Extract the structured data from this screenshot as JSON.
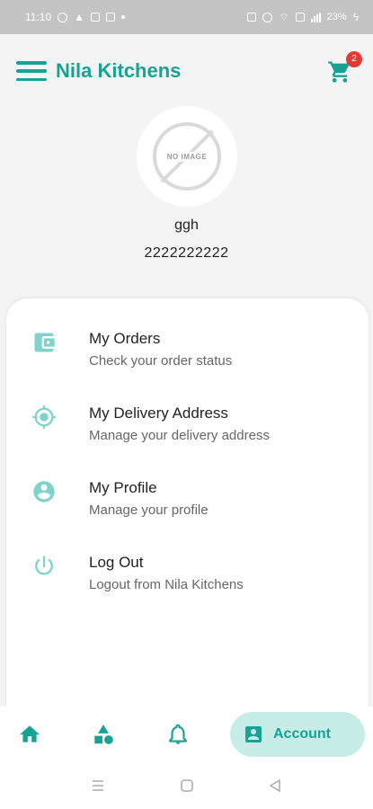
{
  "status_bar": {
    "time": "11:10",
    "battery": "23%"
  },
  "header": {
    "title": "Nila Kitchens",
    "cart_count": "2"
  },
  "profile": {
    "avatar_placeholder": "NO IMAGE",
    "name": "ggh",
    "phone": "2222222222"
  },
  "menu": {
    "items": [
      {
        "title": "My Orders",
        "subtitle": "Check your order status",
        "icon": "wallet-icon"
      },
      {
        "title": "My Delivery Address",
        "subtitle": "Manage your delivery address",
        "icon": "location-target-icon"
      },
      {
        "title": "My Profile",
        "subtitle": "Manage your profile",
        "icon": "account-circle-icon"
      },
      {
        "title": "Log Out",
        "subtitle": "Logout from Nila Kitchens",
        "icon": "power-icon"
      }
    ]
  },
  "bottom_nav": {
    "items": [
      "home-icon",
      "categories-icon",
      "notifications-icon",
      "account-icon"
    ],
    "active_label": "Account"
  },
  "colors": {
    "accent": "#16a394",
    "active_pill": "#c7ede8",
    "badge": "#e53935",
    "status_bar": "#c4c4c4"
  }
}
